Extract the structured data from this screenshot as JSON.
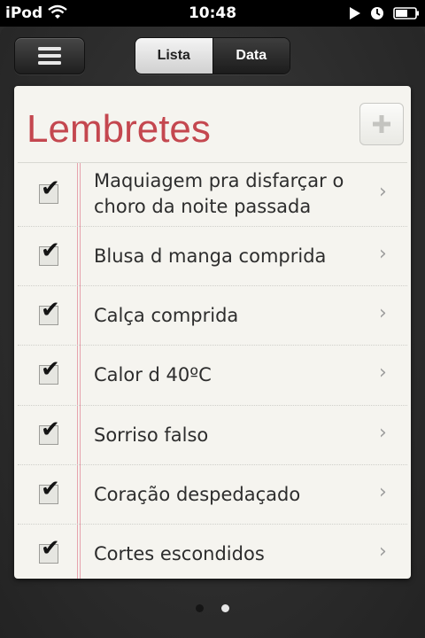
{
  "status_bar": {
    "carrier": "iPod",
    "time": "10:48",
    "icons": [
      "wifi-icon",
      "play-icon",
      "clock-icon",
      "battery-icon"
    ]
  },
  "toolbar": {
    "menu_icon": "hamburger-icon",
    "segments": [
      {
        "label": "Lista",
        "selected": true
      },
      {
        "label": "Data",
        "selected": false
      }
    ]
  },
  "reminders": {
    "title": "Lembretes",
    "add_icon": "plus-icon",
    "items": [
      {
        "label": "Maquiagem pra disfarçar o choro da noite passada",
        "completed": true
      },
      {
        "label": "Blusa d manga comprida",
        "completed": true
      },
      {
        "label": "Calça comprida",
        "completed": true
      },
      {
        "label": "Calor d 40ºC",
        "completed": true
      },
      {
        "label": "Sorriso falso",
        "completed": true
      },
      {
        "label": "Coração despedaçado",
        "completed": true
      },
      {
        "label": "Cortes escondidos",
        "completed": true
      }
    ]
  },
  "page_indicator": {
    "total": 2,
    "current": 2
  },
  "colors": {
    "title": "#c4474f",
    "margin_line": "#e6a3ad",
    "paper": "#f5f4ef",
    "background": "#2c2c2c"
  }
}
